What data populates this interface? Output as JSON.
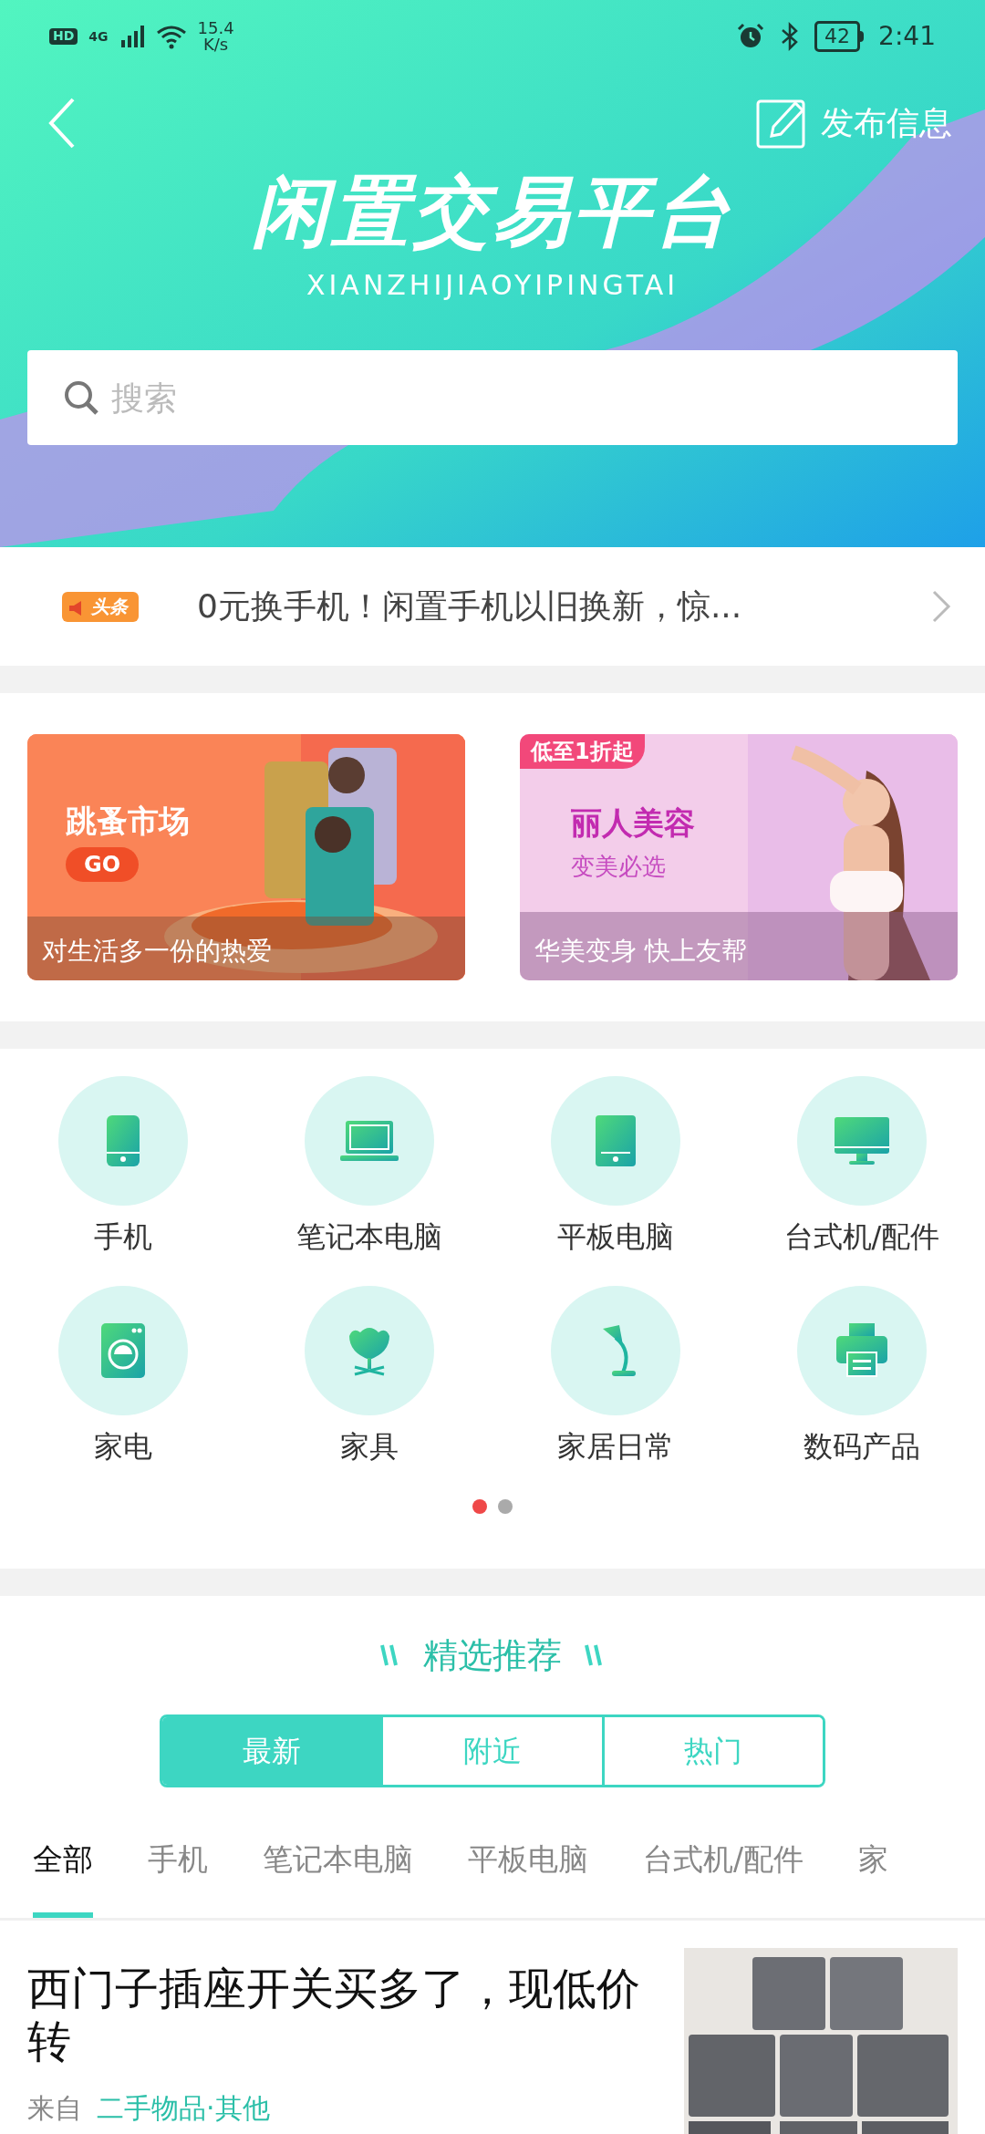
{
  "status_bar": {
    "hd": "HD",
    "network": "4G",
    "speed": "15.4",
    "speed_unit": "K/s",
    "battery": "42",
    "time": "2:41"
  },
  "header": {
    "publish": "发布信息",
    "title": "闲置交易平台",
    "subtitle": "XIANZHIJIAOYIPINGTAI",
    "search": {
      "placeholder": "搜索"
    }
  },
  "news": {
    "badge": "头条",
    "text": "0元换手机！闲置手机以旧换新，惊..."
  },
  "banners": [
    {
      "kind": "market",
      "title": "跳蚤市场",
      "button": "GO",
      "caption": "对生活多一份的热爱"
    },
    {
      "kind": "beauty",
      "tag": "低至1折起",
      "title": "丽人美容",
      "subtitle": "变美必选",
      "caption": "华美变身 快上友帮"
    }
  ],
  "categories": [
    {
      "label": "手机",
      "kind": "phone"
    },
    {
      "label": "笔记本电脑",
      "kind": "laptop"
    },
    {
      "label": "平板电脑",
      "kind": "tablet"
    },
    {
      "label": "台式机/配件",
      "kind": "desktop"
    },
    {
      "label": "家电",
      "kind": "washer"
    },
    {
      "label": "家具",
      "kind": "chair"
    },
    {
      "label": "家居日常",
      "kind": "lamp"
    },
    {
      "label": "数码产品",
      "kind": "printer"
    }
  ],
  "pages": [
    {
      "selected": true
    },
    {
      "selected": false
    }
  ],
  "featured": {
    "title": "精选推荐",
    "sort_tabs": [
      {
        "label": "最新",
        "selected": true
      },
      {
        "label": "附近",
        "selected": false
      },
      {
        "label": "热门",
        "selected": false
      }
    ],
    "category_tabs": [
      {
        "label": "全部",
        "selected": true
      },
      {
        "label": "手机",
        "selected": false
      },
      {
        "label": "笔记本电脑",
        "selected": false
      },
      {
        "label": "平板电脑",
        "selected": false
      },
      {
        "label": "台式机/配件",
        "selected": false
      },
      {
        "label": "家",
        "selected": false
      }
    ]
  },
  "listing": {
    "title": "西门子插座开关买多了，现低价转",
    "from_label": "来自",
    "category": "二手物品·其他"
  }
}
